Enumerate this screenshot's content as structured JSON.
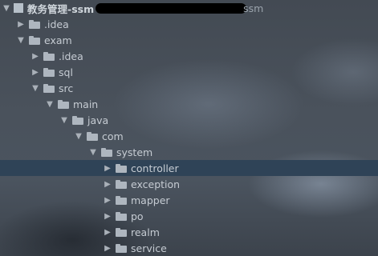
{
  "project_root": {
    "name": "教务管理-ssm",
    "path_tail": "ssm"
  },
  "tree": [
    {
      "label": ".idea",
      "expanded": false
    },
    {
      "label": "exam",
      "expanded": true
    },
    {
      "label": ".idea",
      "expanded": false
    },
    {
      "label": "sql",
      "expanded": false
    },
    {
      "label": "src",
      "expanded": true
    },
    {
      "label": "main",
      "expanded": true
    },
    {
      "label": "java",
      "expanded": true
    },
    {
      "label": "com",
      "expanded": true
    },
    {
      "label": "system",
      "expanded": true
    },
    {
      "label": "controller",
      "expanded": false,
      "selected": true
    },
    {
      "label": "exception",
      "expanded": false
    },
    {
      "label": "mapper",
      "expanded": false
    },
    {
      "label": "po",
      "expanded": false
    },
    {
      "label": "realm",
      "expanded": false
    },
    {
      "label": "service",
      "expanded": false
    }
  ],
  "colors": {
    "selection": "#2f4357",
    "folder": "#aeb6bf",
    "text": "#c6ccd3"
  },
  "icons": {
    "folder": "folder-icon",
    "expand": "chevron-down-icon",
    "collapse": "chevron-right-icon"
  }
}
